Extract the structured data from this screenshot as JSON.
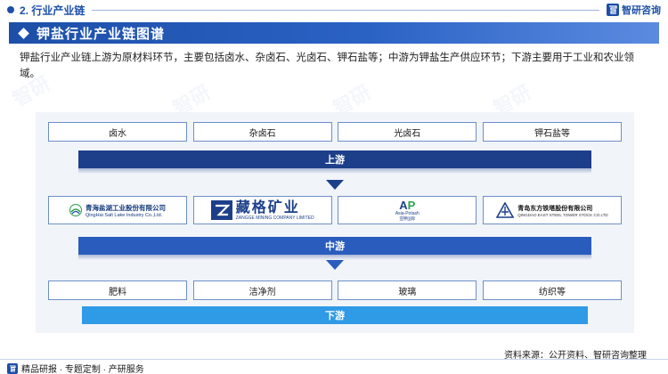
{
  "header": {
    "section_label": "2. 行业产业链",
    "brand_name": "智研咨询"
  },
  "title": "钾盐行业产业链图谱",
  "intro": "钾盐行业产业链上游为原材料环节，主要包括卤水、杂卤石、光卤石、钾石盐等；中游为钾盐生产供应环节；下游主要用于工业和农业领域。",
  "upstream": {
    "items": [
      "卤水",
      "杂卤石",
      "光卤石",
      "钾石盐等"
    ],
    "label": "上游"
  },
  "midstream": {
    "companies": [
      {
        "cn": "青海盐湖工业股份有限公司",
        "en": "QingHai Salt Lake Industry Co.,Ltd."
      },
      {
        "cn": "藏格矿业",
        "en": "ZANGGE MINING COMPANY LIMITED"
      },
      {
        "cn": "亚钾国际",
        "en": "Asia-Potash",
        "mark": "AP"
      },
      {
        "cn": "青岛东方铁塔股份有限公司",
        "en": "QINGDAO EAST STEEL TOWER STOCK CO.LTD"
      }
    ],
    "label": "中游"
  },
  "downstream": {
    "items": [
      "肥料",
      "洁净剂",
      "玻璃",
      "纺织等"
    ],
    "label": "下游"
  },
  "footer": {
    "left_text": "精品研报 · 专题定制 · 产研服务",
    "source": "资料来源：公开资料、智研咨询整理"
  },
  "colors": {
    "primary": "#1d4fa8",
    "upstream_bar": "#1d3f8a",
    "midstream_bar": "#2a5cbe",
    "downstream_bar": "#2f9ae6",
    "panel_bg": "#f1f4f9"
  }
}
